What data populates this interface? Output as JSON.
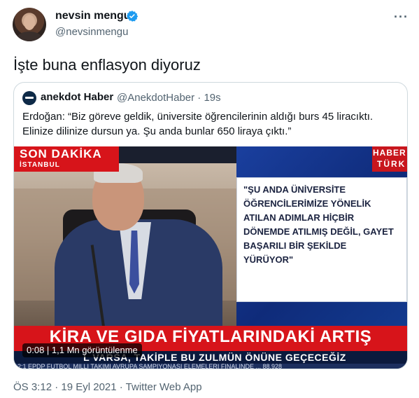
{
  "author": {
    "name": "nevsin mengu",
    "handle": "@nevsinmengu"
  },
  "tweet": {
    "text": "İşte buna enflasyon diyoruz",
    "more_icon": "···",
    "timestamp": "ÖS 3:12 · 19 Eyl 2021 ·",
    "source": "Twitter Web App"
  },
  "quoted": {
    "name": "anekdot Haber",
    "handle": "@AnekdotHaber · 19s",
    "text": "Erdoğan: “Biz göreve geldik, üniversite öğrencilerinin aldığı burs 45 liracıktı. Elinize dilinize dursun ya. Şu anda bunlar 650 liraya çıktı.”"
  },
  "video": {
    "banner_title": "SON DAKİKA",
    "banner_location": "İSTANBUL",
    "channel_top": "HABER",
    "channel_bottom": "TÜRK",
    "quote_card": "\"ŞU ANDA ÜNİVERSİTE ÖĞRENCİLERİMİZE YÖNELİK ATILAN ADIMLAR HİÇBİR DÖNEMDE ATILMIŞ DEĞİL, GAYET BAŞARILI BİR ŞEKİLDE YÜRÜYOR\"",
    "headline": "KİRA VE GIDA FİYATLARINDAKİ ARTIŞ",
    "subline": "L VARSA, TAKİPLE BU ZULMÜN ÖNÜNE GEÇECEĞİZ",
    "ticker": "12:1   EPDP   FUTBOL MİLLİ TAKIMI AVRUPA ŞAMPİYONASI ELEMELERİ FİNALİNDE ...   88.928",
    "time": "0:08",
    "views": "1,1 Mn görüntülenme"
  },
  "colors": {
    "verified": "#1d9bf0",
    "breaking_red": "#d7141a",
    "muted_text": "#536471"
  }
}
